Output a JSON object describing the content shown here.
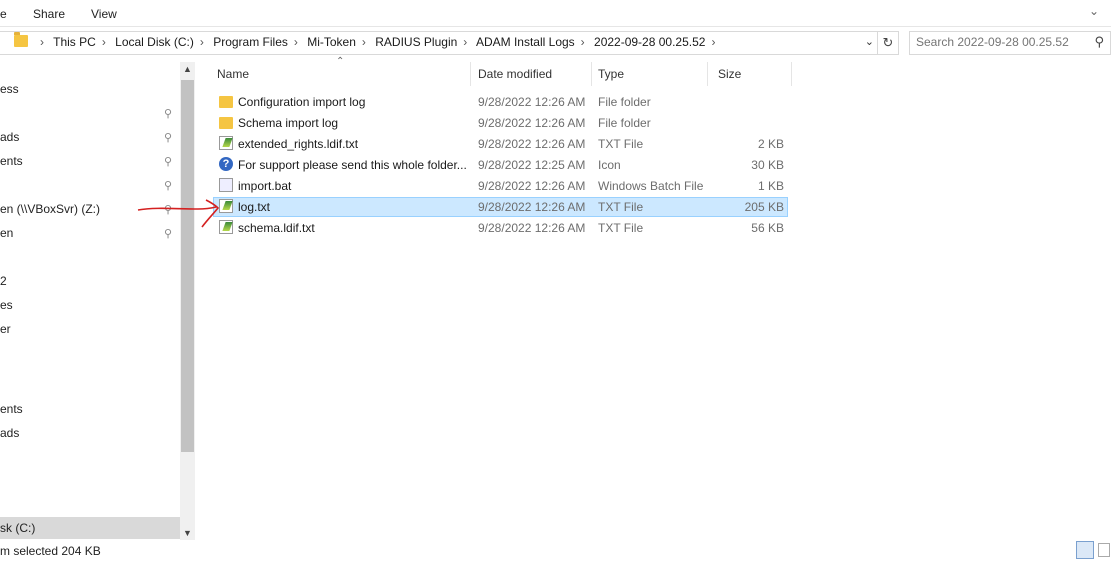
{
  "ribbon": {
    "tabs": [
      "e",
      "Share",
      "View"
    ]
  },
  "address": {
    "crumbs": [
      "This PC",
      "Local Disk (C:)",
      "Program Files",
      "Mi-Token",
      "RADIUS Plugin",
      "ADAM Install Logs",
      "2022-09-28 00.25.52"
    ]
  },
  "search": {
    "placeholder": "Search 2022-09-28 00.25.52"
  },
  "nav": {
    "items": [
      "ess",
      "ads",
      "ents",
      "en (\\\\VBoxSvr) (Z:)",
      "en",
      "2",
      "es",
      "er",
      "ents",
      "ads",
      "sk (C:)"
    ]
  },
  "columns": {
    "name": "Name",
    "date": "Date modified",
    "type": "Type",
    "size": "Size"
  },
  "files": [
    {
      "name": "Configuration import log",
      "date": "9/28/2022 12:26 AM",
      "type": "File folder",
      "size": "",
      "icon": "folder-icon"
    },
    {
      "name": "Schema import log",
      "date": "9/28/2022 12:26 AM",
      "type": "File folder",
      "size": "",
      "icon": "folder-icon"
    },
    {
      "name": "extended_rights.ldif.txt",
      "date": "9/28/2022 12:26 AM",
      "type": "TXT File",
      "size": "2 KB",
      "icon": "text-file-icon"
    },
    {
      "name": "For support please send this whole folder...",
      "date": "9/28/2022 12:25 AM",
      "type": "Icon",
      "size": "30 KB",
      "icon": "question-icon"
    },
    {
      "name": "import.bat",
      "date": "9/28/2022 12:26 AM",
      "type": "Windows Batch File",
      "size": "1 KB",
      "icon": "batch-file-icon"
    },
    {
      "name": "log.txt",
      "date": "9/28/2022 12:26 AM",
      "type": "TXT File",
      "size": "205 KB",
      "icon": "text-file-icon"
    },
    {
      "name": "schema.ldif.txt",
      "date": "9/28/2022 12:26 AM",
      "type": "TXT File",
      "size": "56 KB",
      "icon": "text-file-icon"
    }
  ],
  "status": {
    "selection": "m selected  204 KB"
  },
  "colors": {
    "selected_row": "#cce8ff",
    "selected_border": "#99d1ff",
    "annotation": "#d42020"
  }
}
